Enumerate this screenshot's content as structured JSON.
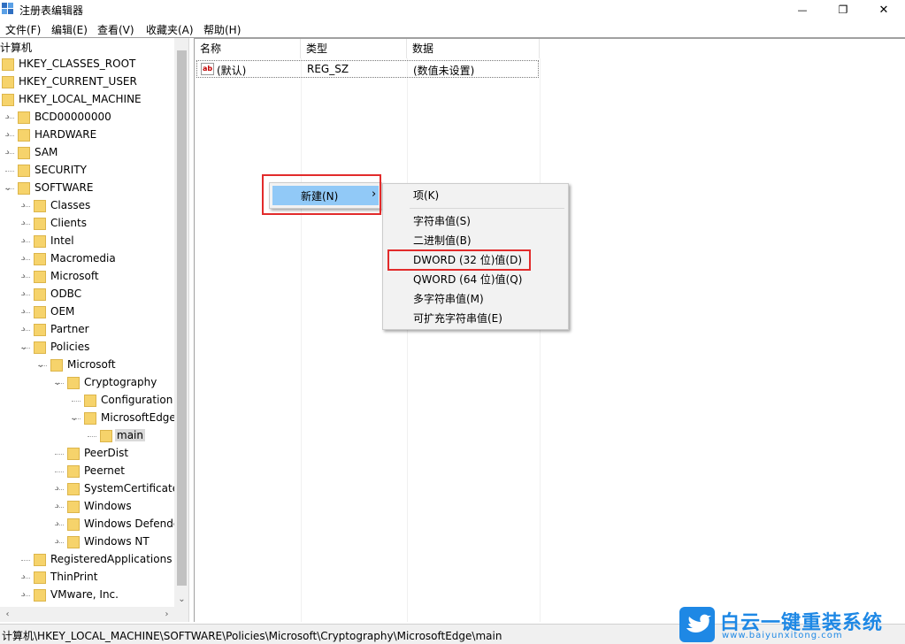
{
  "window": {
    "title": "注册表编辑器",
    "minimize_glyph": "—",
    "maximize_glyph": "❐",
    "close_glyph": "✕"
  },
  "menubar": {
    "items": [
      "文件(F)",
      "编辑(E)",
      "查看(V)",
      "收藏夹(A)",
      "帮助(H)"
    ]
  },
  "tree": {
    "rows": [
      {
        "label": "计算机",
        "level": 0,
        "expander": "",
        "folder": false
      },
      {
        "label": "HKEY_CLASSES_ROOT",
        "level": 1,
        "expander": "",
        "folder": true
      },
      {
        "label": "HKEY_CURRENT_USER",
        "level": 1,
        "expander": "",
        "folder": true
      },
      {
        "label": "HKEY_LOCAL_MACHINE",
        "level": 1,
        "expander": "",
        "folder": true
      },
      {
        "label": "BCD00000000",
        "level": 2,
        "expander": "›",
        "folder": true
      },
      {
        "label": "HARDWARE",
        "level": 2,
        "expander": "›",
        "folder": true
      },
      {
        "label": "SAM",
        "level": 2,
        "expander": "›",
        "folder": true
      },
      {
        "label": "SECURITY",
        "level": 2,
        "expander": "",
        "folder": true
      },
      {
        "label": "SOFTWARE",
        "level": 2,
        "expander": "⌄",
        "folder": true
      },
      {
        "label": "Classes",
        "level": 3,
        "expander": "›",
        "folder": true
      },
      {
        "label": "Clients",
        "level": 3,
        "expander": "›",
        "folder": true
      },
      {
        "label": "Intel",
        "level": 3,
        "expander": "›",
        "folder": true
      },
      {
        "label": "Macromedia",
        "level": 3,
        "expander": "›",
        "folder": true
      },
      {
        "label": "Microsoft",
        "level": 3,
        "expander": "›",
        "folder": true
      },
      {
        "label": "ODBC",
        "level": 3,
        "expander": "›",
        "folder": true
      },
      {
        "label": "OEM",
        "level": 3,
        "expander": "›",
        "folder": true
      },
      {
        "label": "Partner",
        "level": 3,
        "expander": "›",
        "folder": true
      },
      {
        "label": "Policies",
        "level": 3,
        "expander": "⌄",
        "folder": true
      },
      {
        "label": "Microsoft",
        "level": 4,
        "expander": "⌄",
        "folder": true
      },
      {
        "label": "Cryptography",
        "level": 5,
        "expander": "⌄",
        "folder": true
      },
      {
        "label": "Configuration",
        "level": 6,
        "expander": "",
        "folder": true
      },
      {
        "label": "MicrosoftEdge",
        "level": 6,
        "expander": "⌄",
        "folder": true
      },
      {
        "label": "main",
        "level": 7,
        "expander": "",
        "folder": true,
        "selected": true
      },
      {
        "label": "PeerDist",
        "level": 5,
        "expander": "",
        "folder": true
      },
      {
        "label": "Peernet",
        "level": 5,
        "expander": "",
        "folder": true
      },
      {
        "label": "SystemCertificates",
        "level": 5,
        "expander": "›",
        "folder": true
      },
      {
        "label": "Windows",
        "level": 5,
        "expander": "›",
        "folder": true
      },
      {
        "label": "Windows Defender",
        "level": 5,
        "expander": "›",
        "folder": true
      },
      {
        "label": "Windows NT",
        "level": 5,
        "expander": "›",
        "folder": true
      },
      {
        "label": "RegisteredApplications",
        "level": 3,
        "expander": "",
        "folder": true
      },
      {
        "label": "ThinPrint",
        "level": 3,
        "expander": "›",
        "folder": true
      },
      {
        "label": "VMware, Inc.",
        "level": 3,
        "expander": "›",
        "folder": true
      }
    ]
  },
  "list": {
    "headers": {
      "name": "名称",
      "type": "类型",
      "data": "数据"
    },
    "rows": [
      {
        "icon": "ab",
        "name": "(默认)",
        "type": "REG_SZ",
        "data": "(数值未设置)"
      }
    ]
  },
  "context_menu": {
    "new_label": "新建(N)",
    "new_arrow": "›",
    "submenu": {
      "key": "项(K)",
      "items": [
        "字符串值(S)",
        "二进制值(B)",
        "DWORD (32 位)值(D)",
        "QWORD (64 位)值(Q)",
        "多字符串值(M)",
        "可扩充字符串值(E)"
      ]
    }
  },
  "scrollbar": {
    "down_arrow": "⌄",
    "left_arrow": "‹",
    "right_arrow": "›"
  },
  "statusbar": {
    "path": "计算机\\HKEY_LOCAL_MACHINE\\SOFTWARE\\Policies\\Microsoft\\Cryptography\\MicrosoftEdge\\main"
  },
  "watermark": {
    "text": "白云一键重装系统",
    "url": "www.baiyunxitong.com"
  },
  "colors": {
    "highlight_red": "#e22b2b",
    "menu_hover_blue": "#91c9f7",
    "folder_yellow": "#f6d36b",
    "watermark_blue": "#1e88e5"
  }
}
